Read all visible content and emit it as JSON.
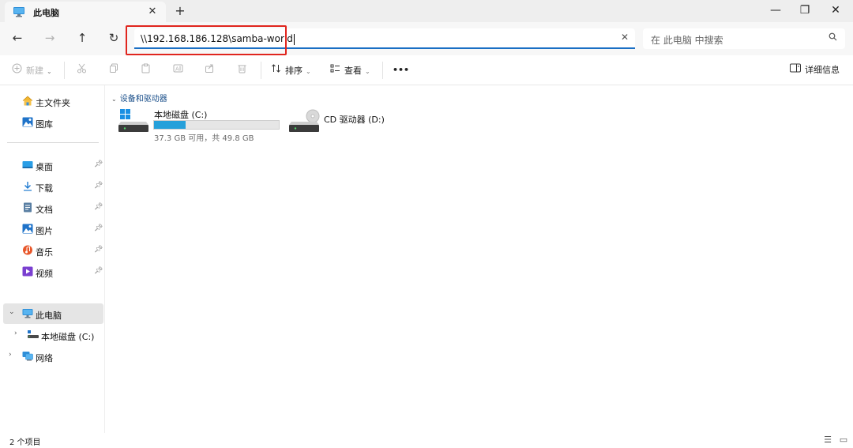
{
  "window": {
    "tab_title": "此电脑",
    "tab_close": "✕",
    "new_tab": "+",
    "minimize": "—",
    "maximize": "❐",
    "close": "✕"
  },
  "nav": {
    "back": "←",
    "forward": "→",
    "up": "↑",
    "refresh": "↻",
    "address_value": "\\\\192.168.186.128\\samba-world",
    "address_clear": "✕",
    "search_placeholder": "在 此电脑 中搜索"
  },
  "toolbar": {
    "new_label": "新建",
    "sort_label": "排序",
    "view_label": "查看",
    "more_label": "•••",
    "details_label": "详细信息"
  },
  "sidebar": {
    "quick": [
      {
        "label": "主文件夹",
        "icon": "home-icon"
      },
      {
        "label": "图库",
        "icon": "gallery-icon"
      }
    ],
    "pinned": [
      {
        "label": "桌面",
        "icon": "desktop-icon"
      },
      {
        "label": "下载",
        "icon": "download-icon"
      },
      {
        "label": "文档",
        "icon": "document-icon"
      },
      {
        "label": "图片",
        "icon": "pictures-icon"
      },
      {
        "label": "音乐",
        "icon": "music-icon"
      },
      {
        "label": "视频",
        "icon": "video-icon"
      }
    ],
    "tree": [
      {
        "label": "此电脑",
        "icon": "computer-icon",
        "selected": true
      },
      {
        "label": "本地磁盘 (C:)",
        "icon": "drive-icon"
      },
      {
        "label": "网络",
        "icon": "network-icon"
      }
    ]
  },
  "main": {
    "group_header": "设备和驱动器",
    "drives": [
      {
        "name": "本地磁盘 (C:)",
        "space": "37.3 GB 可用，共 49.8 GB",
        "used_fraction": 0.25
      },
      {
        "name": "CD 驱动器 (D:)"
      }
    ]
  },
  "status": {
    "item_count": "2 个项目"
  },
  "colors": {
    "accent": "#1a6fc4",
    "highlight_box": "#e0251e",
    "drive_fill": "#26a0da"
  }
}
